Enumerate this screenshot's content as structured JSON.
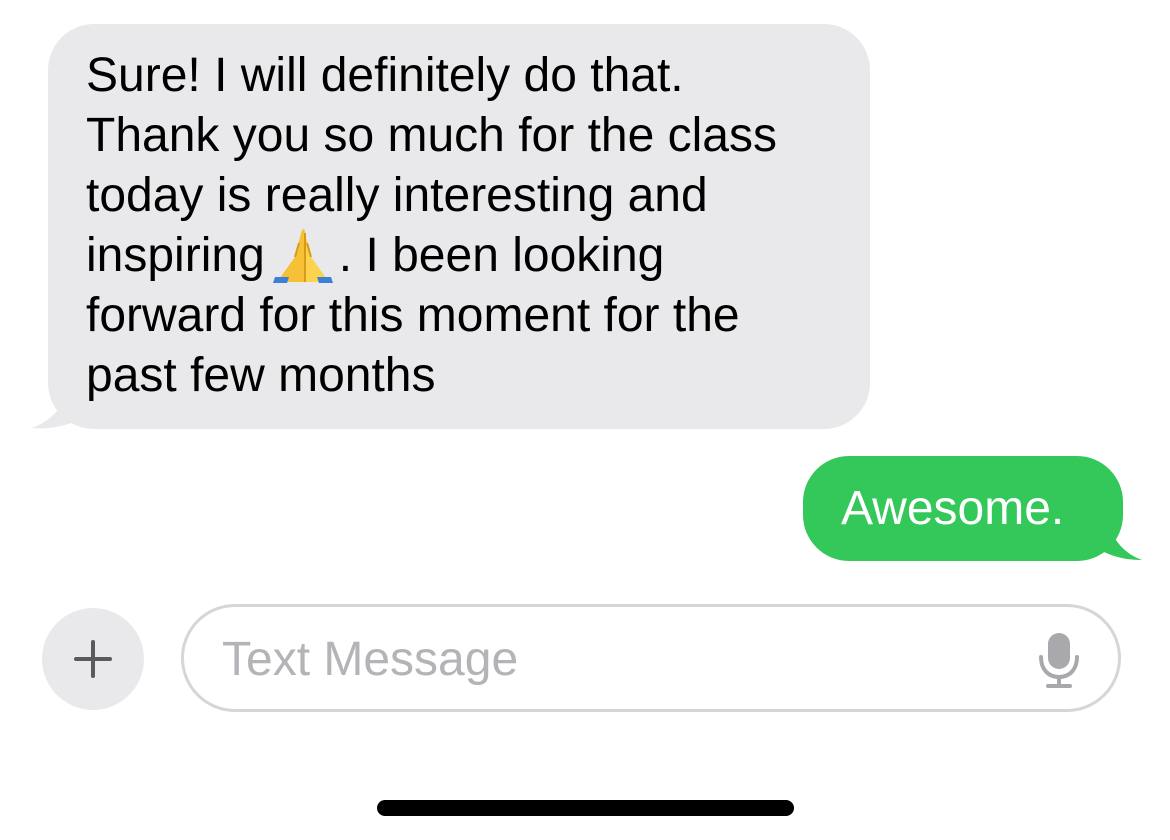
{
  "conversation": {
    "received_message": {
      "lines": [
        "Sure! I will definitely do that.",
        "Thank you so much for the class",
        "today is really interesting and",
        "inspiring",
        ". I been looking",
        "forward for this moment for the",
        "past few months"
      ],
      "emoji_icon": "folded-hands-icon",
      "bubble_color": "#e9e9eb",
      "text_color": "#000000"
    },
    "sent_message": {
      "text": "Awesome.",
      "bubble_color": "#34c759",
      "text_color": "#ffffff"
    }
  },
  "composer": {
    "add_icon": "plus-icon",
    "placeholder": "Text Message",
    "value": "",
    "mic_icon": "microphone-icon"
  }
}
